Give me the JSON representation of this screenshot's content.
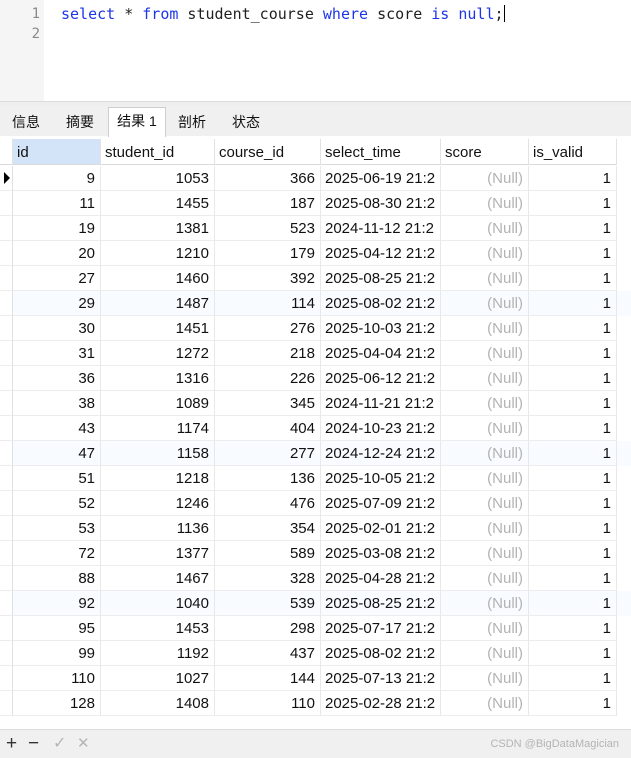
{
  "editor": {
    "line_numbers": [
      "1",
      "2"
    ],
    "sql": {
      "kw_select": "select",
      "star": " * ",
      "kw_from": "from",
      "table": " student_course ",
      "kw_where": "where",
      "col": " score ",
      "kw_is": "is",
      "sp": " ",
      "kw_null": "null",
      "end": ";"
    }
  },
  "tabs": [
    {
      "label": "信息",
      "active": false
    },
    {
      "label": "摘要",
      "active": false
    },
    {
      "label": "结果 1",
      "active": true
    },
    {
      "label": "剖析",
      "active": false
    },
    {
      "label": "状态",
      "active": false
    }
  ],
  "grid": {
    "columns": [
      "id",
      "student_id",
      "course_id",
      "select_time",
      "score",
      "is_valid"
    ],
    "selected_column": "id",
    "current_row": 0,
    "null_label": "(Null)",
    "rows": [
      [
        "9",
        "1053",
        "366",
        "2025-06-19 21:2",
        "(Null)",
        "1"
      ],
      [
        "11",
        "1455",
        "187",
        "2025-08-30 21:2",
        "(Null)",
        "1"
      ],
      [
        "19",
        "1381",
        "523",
        "2024-11-12 21:2",
        "(Null)",
        "1"
      ],
      [
        "20",
        "1210",
        "179",
        "2025-04-12 21:2",
        "(Null)",
        "1"
      ],
      [
        "27",
        "1460",
        "392",
        "2025-08-25 21:2",
        "(Null)",
        "1"
      ],
      [
        "29",
        "1487",
        "114",
        "2025-08-02 21:2",
        "(Null)",
        "1"
      ],
      [
        "30",
        "1451",
        "276",
        "2025-10-03 21:2",
        "(Null)",
        "1"
      ],
      [
        "31",
        "1272",
        "218",
        "2025-04-04 21:2",
        "(Null)",
        "1"
      ],
      [
        "36",
        "1316",
        "226",
        "2025-06-12 21:2",
        "(Null)",
        "1"
      ],
      [
        "38",
        "1089",
        "345",
        "2024-11-21 21:2",
        "(Null)",
        "1"
      ],
      [
        "43",
        "1174",
        "404",
        "2024-10-23 21:2",
        "(Null)",
        "1"
      ],
      [
        "47",
        "1158",
        "277",
        "2024-12-24 21:2",
        "(Null)",
        "1"
      ],
      [
        "51",
        "1218",
        "136",
        "2025-10-05 21:2",
        "(Null)",
        "1"
      ],
      [
        "52",
        "1246",
        "476",
        "2025-07-09 21:2",
        "(Null)",
        "1"
      ],
      [
        "53",
        "1136",
        "354",
        "2025-02-01 21:2",
        "(Null)",
        "1"
      ],
      [
        "72",
        "1377",
        "589",
        "2025-03-08 21:2",
        "(Null)",
        "1"
      ],
      [
        "88",
        "1467",
        "328",
        "2025-04-28 21:2",
        "(Null)",
        "1"
      ],
      [
        "92",
        "1040",
        "539",
        "2025-08-25 21:2",
        "(Null)",
        "1"
      ],
      [
        "95",
        "1453",
        "298",
        "2025-07-17 21:2",
        "(Null)",
        "1"
      ],
      [
        "99",
        "1192",
        "437",
        "2025-08-02 21:2",
        "(Null)",
        "1"
      ],
      [
        "110",
        "1027",
        "144",
        "2025-07-13 21:2",
        "(Null)",
        "1"
      ],
      [
        "128",
        "1408",
        "110",
        "2025-02-28 21:2",
        "(Null)",
        "1"
      ]
    ]
  },
  "toolbar": {
    "add_icon": "plus-icon",
    "add_label": "+",
    "delete_icon": "minus-icon",
    "delete_label": "−",
    "apply_icon": "check-icon",
    "apply_label": "✓",
    "discard_icon": "cross-icon",
    "discard_label": "✕"
  },
  "watermark": "CSDN @BigDataMagician",
  "colors": {
    "keyword": "#1d35e8",
    "null_text": "#b3b3b3",
    "selected_header": "#d3e4f8"
  }
}
